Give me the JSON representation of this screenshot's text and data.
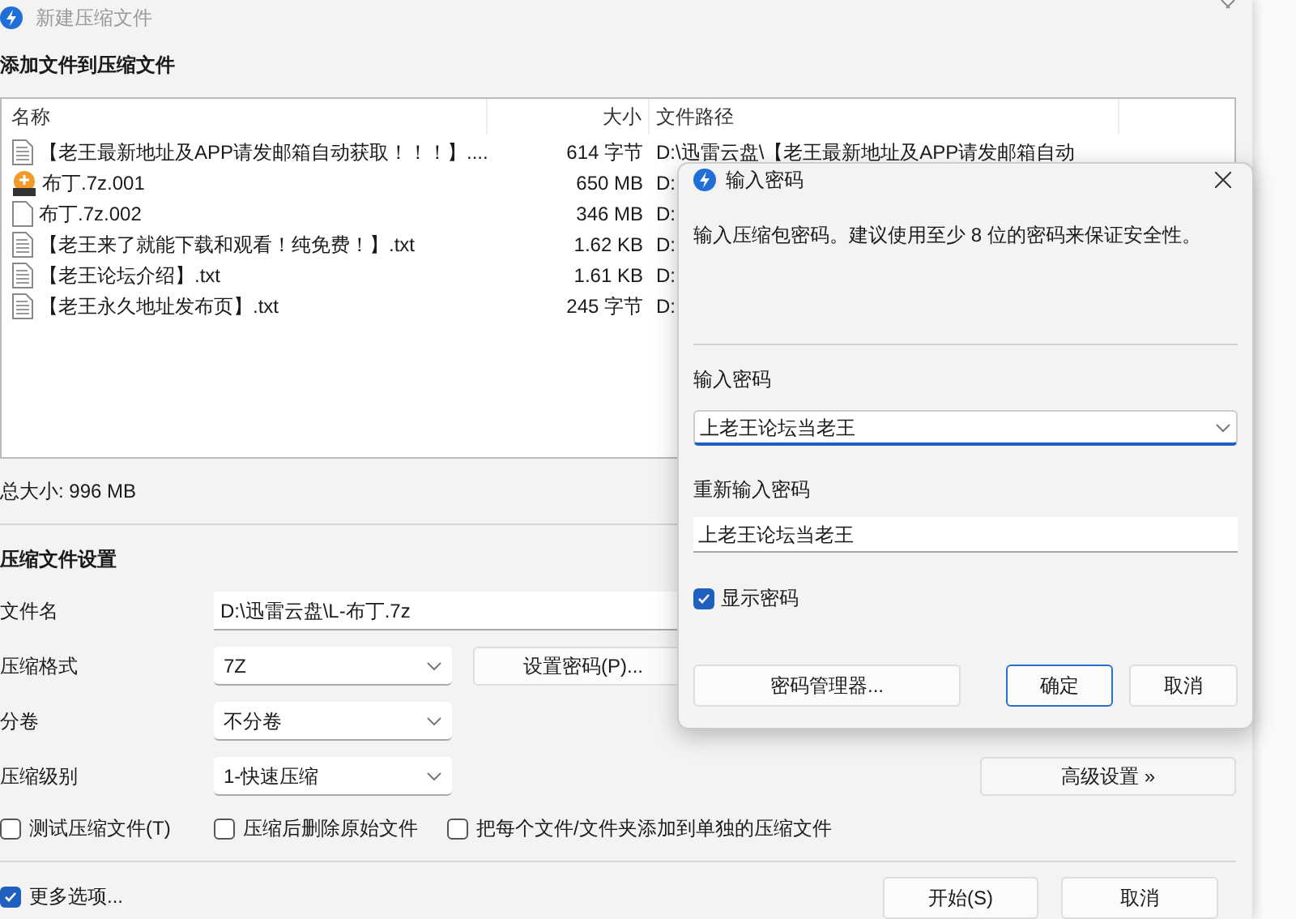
{
  "window": {
    "title": "新建压缩文件"
  },
  "files_section": {
    "title": "添加文件到压缩文件"
  },
  "table": {
    "columns": [
      "名称",
      "大小",
      "文件路径"
    ],
    "rows": [
      {
        "kind": "text",
        "name": "【老王最新地址及APP请发邮箱自动获取！！！】....",
        "size": "614 字节",
        "path": "D:\\迅雷云盘\\【老王最新地址及APP请发邮箱自动"
      },
      {
        "kind": "archive",
        "name": "布丁.7z.001",
        "size": "650 MB",
        "path": "D:"
      },
      {
        "kind": "blank",
        "name": "布丁.7z.002",
        "size": "346 MB",
        "path": "D:"
      },
      {
        "kind": "text",
        "name": "【老王来了就能下载和观看！纯免费！】.txt",
        "size": "1.62 KB",
        "path": "D:"
      },
      {
        "kind": "text",
        "name": "【老王论坛介绍】.txt",
        "size": "1.61 KB",
        "path": "D:"
      },
      {
        "kind": "text",
        "name": "【老王永久地址发布页】.txt",
        "size": "245 字节",
        "path": "D:"
      }
    ]
  },
  "total_size": "总大小: 996 MB",
  "settings": {
    "title": "压缩文件设置",
    "filename": {
      "label": "文件名",
      "value": "D:\\迅雷云盘\\L-布丁.7z"
    },
    "format": {
      "label": "压缩格式",
      "value": "7Z"
    },
    "set_password_button": "设置密码(P)...",
    "split": {
      "label": "分卷",
      "value": "不分卷"
    },
    "level": {
      "label": "压缩级别",
      "value": "1-快速压缩"
    },
    "advanced_button": "高级设置 »",
    "options": [
      {
        "label": "测试压缩文件(T)",
        "checked": false
      },
      {
        "label": "压缩后删除原始文件",
        "checked": false
      },
      {
        "label": "把每个文件/文件夹添加到单独的压缩文件",
        "checked": false
      }
    ]
  },
  "more_options": {
    "label": "更多选项...",
    "checked": true
  },
  "buttons": [
    "开始(S)",
    "取消"
  ],
  "dialog": {
    "title": "输入密码",
    "description": "输入压缩包密码。建议使用至少 8 位的密码来保证安全性。",
    "password": {
      "label": "输入密码",
      "value": "上老王论坛当老王"
    },
    "confirm": {
      "label": "重新输入密码",
      "value": "上老王论坛当老王"
    },
    "show_password": {
      "label": "显示密码",
      "checked": true
    },
    "buttons": [
      {
        "label": "密码管理器...",
        "default": false
      },
      {
        "label": "确定",
        "default": true
      },
      {
        "label": "取消",
        "default": false
      }
    ]
  }
}
